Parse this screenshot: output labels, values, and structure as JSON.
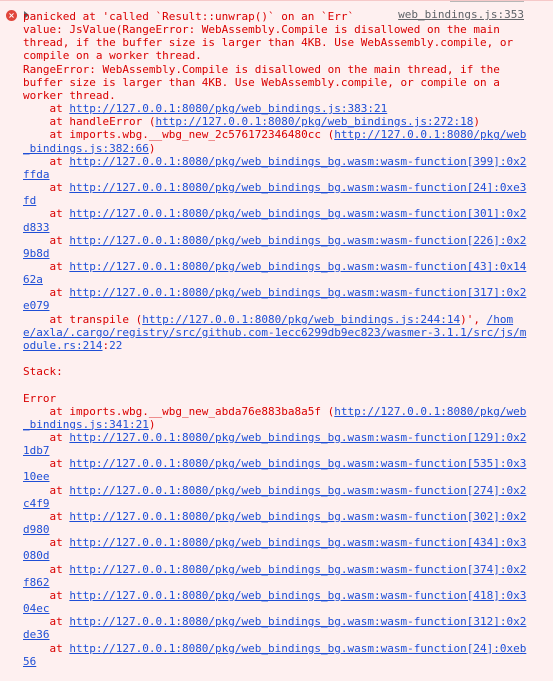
{
  "console": {
    "source_link": "web_bindings.js:353",
    "icon_name": "error-circle-icon",
    "colors": {
      "background": "#fef0f0",
      "text": "#d90000",
      "link": "#1f4fd6"
    },
    "lines": [
      [
        {
          "t": "panicked at 'called `Result::unwrap()` on an `Err`"
        }
      ],
      [
        {
          "t": "value: JsValue(RangeError: WebAssembly.Compile is disallowed on the main"
        }
      ],
      [
        {
          "t": "thread, if the buffer size is larger than 4KB. Use WebAssembly.compile, or"
        }
      ],
      [
        {
          "t": "compile on a worker thread."
        }
      ],
      [
        {
          "t": "RangeError: WebAssembly.Compile is disallowed on the main thread, if the"
        }
      ],
      [
        {
          "t": "buffer size is larger than 4KB. Use WebAssembly.compile, or compile on a"
        }
      ],
      [
        {
          "t": "worker thread."
        }
      ],
      [
        {
          "t": "    at "
        },
        {
          "t": "http://127.0.0.1:8080/pkg/web_bindings.js:383:21",
          "k": "link"
        }
      ],
      [
        {
          "t": "    at handleError ("
        },
        {
          "t": "http://127.0.0.1:8080/pkg/web_bindings.js:272:18",
          "k": "link"
        },
        {
          "t": ")"
        }
      ],
      [
        {
          "t": "    at imports.wbg.__wbg_new_2c576172346480cc ("
        },
        {
          "t": "http://127.0.0.1:8080/pkg/web",
          "k": "link"
        }
      ],
      [
        {
          "t": "_bindings.js:382:66",
          "k": "link"
        },
        {
          "t": ")"
        }
      ],
      [
        {
          "t": "    at "
        },
        {
          "t": "http://127.0.0.1:8080/pkg/web_bindings_bg.wasm:wasm-function[399]:0x2",
          "k": "link"
        }
      ],
      [
        {
          "t": "ffda",
          "k": "link"
        }
      ],
      [
        {
          "t": "    at "
        },
        {
          "t": "http://127.0.0.1:8080/pkg/web_bindings_bg.wasm:wasm-function[24]:0xe3",
          "k": "link"
        }
      ],
      [
        {
          "t": "fd",
          "k": "link"
        }
      ],
      [
        {
          "t": "    at "
        },
        {
          "t": "http://127.0.0.1:8080/pkg/web_bindings_bg.wasm:wasm-function[301]:0x2",
          "k": "link"
        }
      ],
      [
        {
          "t": "d833",
          "k": "link"
        }
      ],
      [
        {
          "t": "    at "
        },
        {
          "t": "http://127.0.0.1:8080/pkg/web_bindings_bg.wasm:wasm-function[226]:0x2",
          "k": "link"
        }
      ],
      [
        {
          "t": "9b8d",
          "k": "link"
        }
      ],
      [
        {
          "t": "    at "
        },
        {
          "t": "http://127.0.0.1:8080/pkg/web_bindings_bg.wasm:wasm-function[43]:0x14",
          "k": "link"
        }
      ],
      [
        {
          "t": "62a",
          "k": "link"
        }
      ],
      [
        {
          "t": "    at "
        },
        {
          "t": "http://127.0.0.1:8080/pkg/web_bindings_bg.wasm:wasm-function[317]:0x2",
          "k": "link"
        }
      ],
      [
        {
          "t": "e079",
          "k": "link"
        }
      ],
      [
        {
          "t": "    at transpile ("
        },
        {
          "t": "http://127.0.0.1:8080/pkg/web_bindings.js:244:14",
          "k": "link"
        },
        {
          "t": ")', "
        },
        {
          "t": "/hom",
          "k": "link"
        }
      ],
      [
        {
          "t": "e/axla/.cargo/registry/src/github.com-1ecc6299db9ec823/wasmer-3.1.1/src/js/m",
          "k": "link"
        }
      ],
      [
        {
          "t": "odule.rs:214",
          "k": "link"
        },
        {
          "t": ":"
        },
        {
          "t": "22",
          "k": "num"
        }
      ],
      [],
      [
        {
          "t": "Stack:"
        }
      ],
      [],
      [
        {
          "t": "Error"
        }
      ],
      [
        {
          "t": "    at imports.wbg.__wbg_new_abda76e883ba8a5f ("
        },
        {
          "t": "http://127.0.0.1:8080/pkg/web",
          "k": "link"
        }
      ],
      [
        {
          "t": "_bindings.js:341:21",
          "k": "link"
        },
        {
          "t": ")"
        }
      ],
      [
        {
          "t": "    at "
        },
        {
          "t": "http://127.0.0.1:8080/pkg/web_bindings_bg.wasm:wasm-function[129]:0x2",
          "k": "link"
        }
      ],
      [
        {
          "t": "1db7",
          "k": "link"
        }
      ],
      [
        {
          "t": "    at "
        },
        {
          "t": "http://127.0.0.1:8080/pkg/web_bindings_bg.wasm:wasm-function[535]:0x3",
          "k": "link"
        }
      ],
      [
        {
          "t": "10ee",
          "k": "link"
        }
      ],
      [
        {
          "t": "    at "
        },
        {
          "t": "http://127.0.0.1:8080/pkg/web_bindings_bg.wasm:wasm-function[274]:0x2",
          "k": "link"
        }
      ],
      [
        {
          "t": "c4f9",
          "k": "link"
        }
      ],
      [
        {
          "t": "    at "
        },
        {
          "t": "http://127.0.0.1:8080/pkg/web_bindings_bg.wasm:wasm-function[302]:0x2",
          "k": "link"
        }
      ],
      [
        {
          "t": "d980",
          "k": "link"
        }
      ],
      [
        {
          "t": "    at "
        },
        {
          "t": "http://127.0.0.1:8080/pkg/web_bindings_bg.wasm:wasm-function[434]:0x3",
          "k": "link"
        }
      ],
      [
        {
          "t": "080d",
          "k": "link"
        }
      ],
      [
        {
          "t": "    at "
        },
        {
          "t": "http://127.0.0.1:8080/pkg/web_bindings_bg.wasm:wasm-function[374]:0x2",
          "k": "link"
        }
      ],
      [
        {
          "t": "f862",
          "k": "link"
        }
      ],
      [
        {
          "t": "    at "
        },
        {
          "t": "http://127.0.0.1:8080/pkg/web_bindings_bg.wasm:wasm-function[418]:0x3",
          "k": "link"
        }
      ],
      [
        {
          "t": "04ec",
          "k": "link"
        }
      ],
      [
        {
          "t": "    at "
        },
        {
          "t": "http://127.0.0.1:8080/pkg/web_bindings_bg.wasm:wasm-function[312]:0x2",
          "k": "link"
        }
      ],
      [
        {
          "t": "de36",
          "k": "link"
        }
      ],
      [
        {
          "t": "    at "
        },
        {
          "t": "http://127.0.0.1:8080/pkg/web_bindings_bg.wasm:wasm-function[24]:0xeb",
          "k": "link"
        }
      ],
      [
        {
          "t": "56",
          "k": "link"
        }
      ]
    ]
  }
}
